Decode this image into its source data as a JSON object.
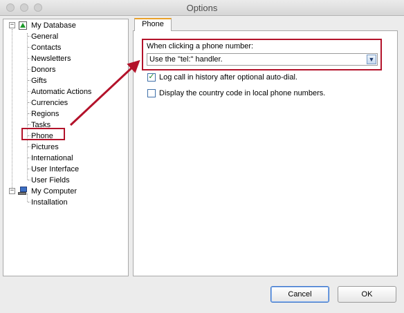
{
  "window": {
    "title": "Options"
  },
  "tree": {
    "root": {
      "label": "My Database"
    },
    "items": [
      "General",
      "Contacts",
      "Newsletters",
      "Donors",
      "Gifts",
      "Automatic Actions",
      "Currencies",
      "Regions",
      "Tasks",
      "Phone",
      "Pictures",
      "International",
      "User Interface",
      "User Fields"
    ],
    "computer": {
      "label": "My Computer"
    },
    "computer_items": [
      "Installation"
    ],
    "selected": "Phone"
  },
  "tabs": [
    {
      "label": "Phone"
    }
  ],
  "phone": {
    "click_label": "When clicking a phone number:",
    "handler_value": "Use the \"tel:\" handler.",
    "log_call": {
      "label": "Log call in history after optional auto-dial.",
      "checked": true
    },
    "country_code": {
      "label": "Display the country code in local phone numbers.",
      "checked": false
    }
  },
  "buttons": {
    "cancel": "Cancel",
    "ok": "OK"
  },
  "colors": {
    "annotation": "#b3122a",
    "tree_icon_green": "#1f9a2b"
  }
}
